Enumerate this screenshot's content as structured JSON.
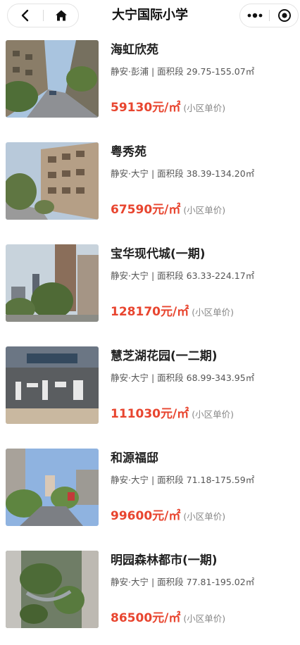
{
  "header": {
    "title": "大宁国际小学"
  },
  "listings": [
    {
      "name": "海虹欣苑",
      "location": "静安·彭浦",
      "area_label": "面积段",
      "area_range": "29.75-155.07㎡",
      "price": "59130元/㎡",
      "price_note": "(小区单价)"
    },
    {
      "name": "粤秀苑",
      "location": "静安·大宁",
      "area_label": "面积段",
      "area_range": "38.39-134.20㎡",
      "price": "67590元/㎡",
      "price_note": "(小区单价)"
    },
    {
      "name": "宝华现代城(一期)",
      "location": "静安·大宁",
      "area_label": "面积段",
      "area_range": "63.33-224.17㎡",
      "price": "128170元/㎡",
      "price_note": "(小区单价)"
    },
    {
      "name": "慧芝湖花园(一二期)",
      "location": "静安·大宁",
      "area_label": "面积段",
      "area_range": "68.99-343.95㎡",
      "price": "111030元/㎡",
      "price_note": "(小区单价)"
    },
    {
      "name": "和源福邸",
      "location": "静安·大宁",
      "area_label": "面积段",
      "area_range": "71.18-175.59㎡",
      "price": "99600元/㎡",
      "price_note": "(小区单价)"
    },
    {
      "name": "明园森林都市(一期)",
      "location": "静安·大宁",
      "area_label": "面积段",
      "area_range": "77.81-195.02㎡",
      "price": "86500元/㎡",
      "price_note": "(小区单价)"
    }
  ],
  "icons": {
    "back": "chevron-left-icon",
    "home": "home-icon",
    "more": "more-dots-icon",
    "target": "target-icon"
  },
  "colors": {
    "price": "#e8452f",
    "text": "#222222",
    "meta": "#555555",
    "note": "#888888"
  }
}
